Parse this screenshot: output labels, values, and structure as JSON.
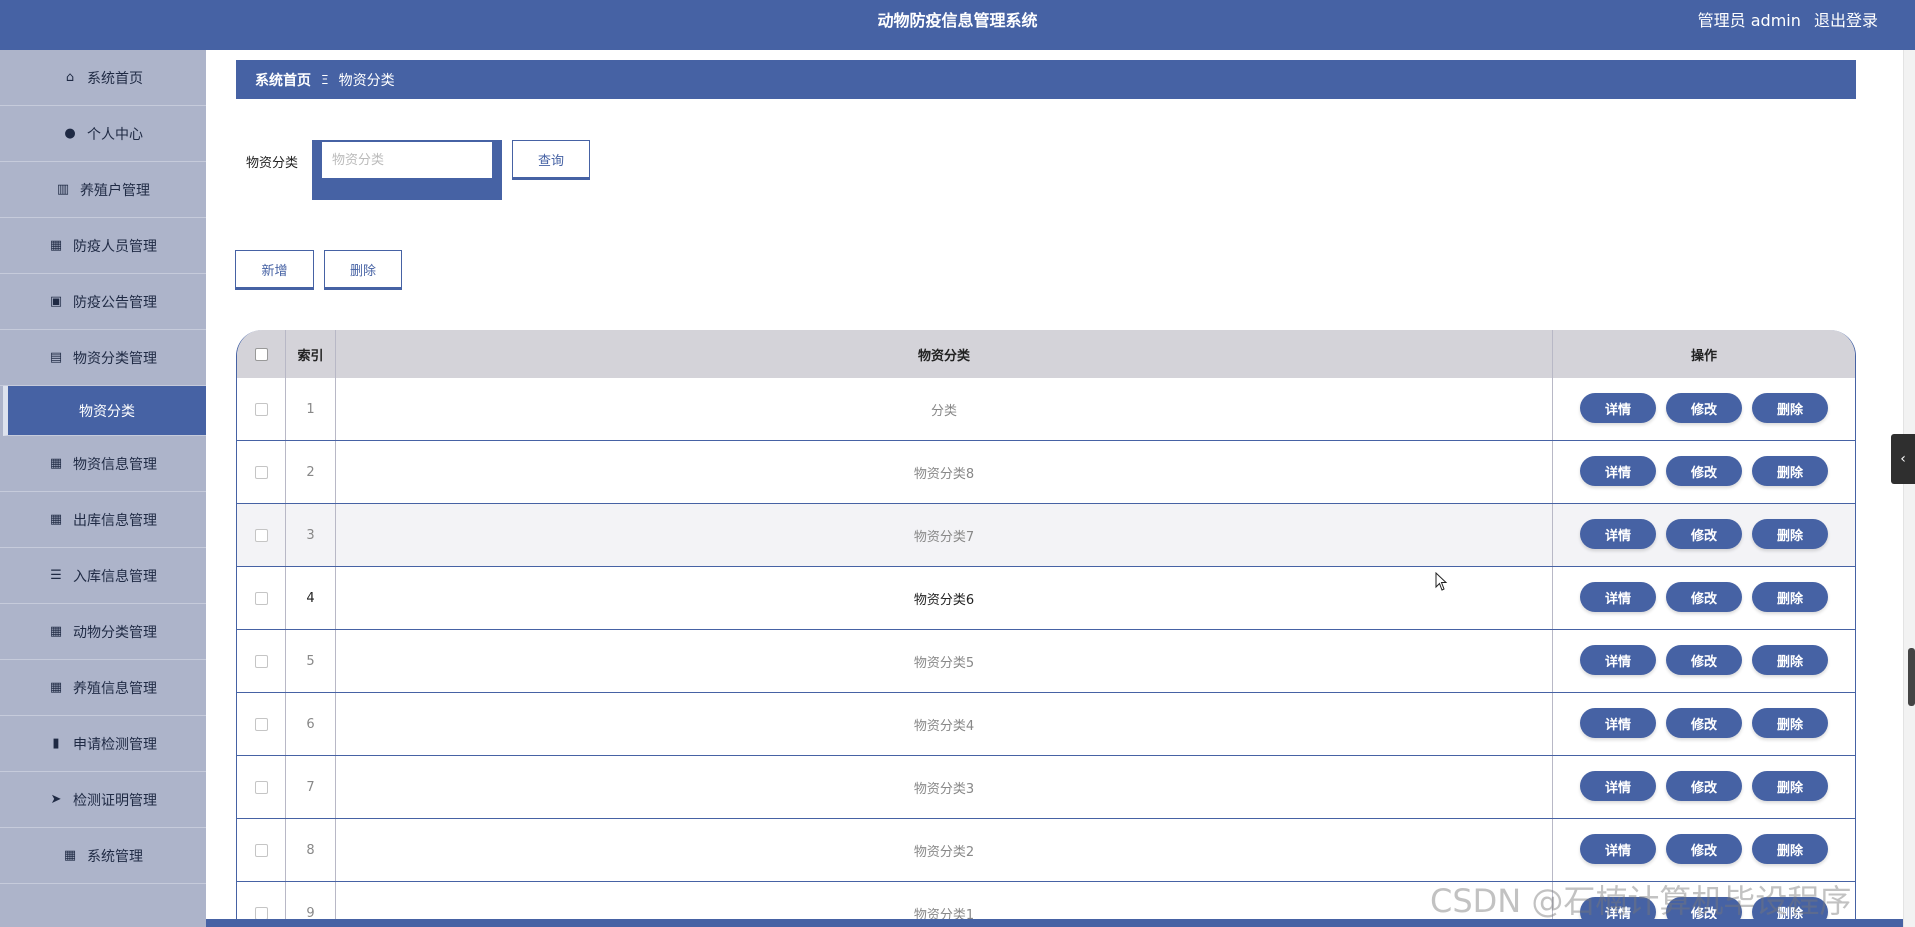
{
  "header": {
    "title": "动物防疫信息管理系统",
    "user_label": "管理员 admin",
    "logout_label": "退出登录"
  },
  "sidebar": {
    "items": [
      {
        "label": "系统首页",
        "icon": "home-icon",
        "glyph": "⌂"
      },
      {
        "label": "个人中心",
        "icon": "user-icon",
        "glyph": "●"
      },
      {
        "label": "养殖户管理",
        "icon": "books-icon",
        "glyph": "▥"
      },
      {
        "label": "防疫人员管理",
        "icon": "grid-icon",
        "glyph": "▦"
      },
      {
        "label": "防疫公告管理",
        "icon": "briefcase-icon",
        "glyph": "▣"
      },
      {
        "label": "物资分类管理",
        "icon": "clipboard-icon",
        "glyph": "▤"
      }
    ],
    "active_sub": {
      "label": "物资分类"
    },
    "items_after": [
      {
        "label": "物资信息管理",
        "icon": "grid-icon",
        "glyph": "▦"
      },
      {
        "label": "出库信息管理",
        "icon": "grid-icon",
        "glyph": "▦"
      },
      {
        "label": "入库信息管理",
        "icon": "list-icon",
        "glyph": "☰"
      },
      {
        "label": "动物分类管理",
        "icon": "apps-icon",
        "glyph": "▦"
      },
      {
        "label": "养殖信息管理",
        "icon": "grid-icon",
        "glyph": "▦"
      },
      {
        "label": "申请检测管理",
        "icon": "bar-chart-icon",
        "glyph": "▮"
      },
      {
        "label": "检测证明管理",
        "icon": "send-icon",
        "glyph": "➤"
      },
      {
        "label": "系统管理",
        "icon": "grid-icon",
        "glyph": "▦"
      }
    ]
  },
  "breadcrumb": {
    "home": "系统首页",
    "separator": "Ξ",
    "current": "物资分类"
  },
  "search": {
    "label": "物资分类",
    "placeholder": "物资分类",
    "value": "",
    "query_label": "查询"
  },
  "actions": {
    "add_label": "新增",
    "delete_label": "删除"
  },
  "table": {
    "headers": {
      "index": "索引",
      "name": "物资分类",
      "ops": "操作"
    },
    "op_labels": {
      "detail": "详情",
      "edit": "修改",
      "delete": "删除"
    },
    "rows": [
      {
        "index": "1",
        "name": "分类"
      },
      {
        "index": "2",
        "name": "物资分类8"
      },
      {
        "index": "3",
        "name": "物资分类7"
      },
      {
        "index": "4",
        "name": "物资分类6"
      },
      {
        "index": "5",
        "name": "物资分类5"
      },
      {
        "index": "6",
        "name": "物资分类4"
      },
      {
        "index": "7",
        "name": "物资分类3"
      },
      {
        "index": "8",
        "name": "物资分类2"
      },
      {
        "index": "9",
        "name": "物资分类1"
      }
    ]
  },
  "watermark": "CSDN @石楠计算机毕设程序",
  "colors": {
    "primary": "#4662a4",
    "sidebar_bg": "#adb4ca",
    "header_row": "#d4d3d9"
  }
}
